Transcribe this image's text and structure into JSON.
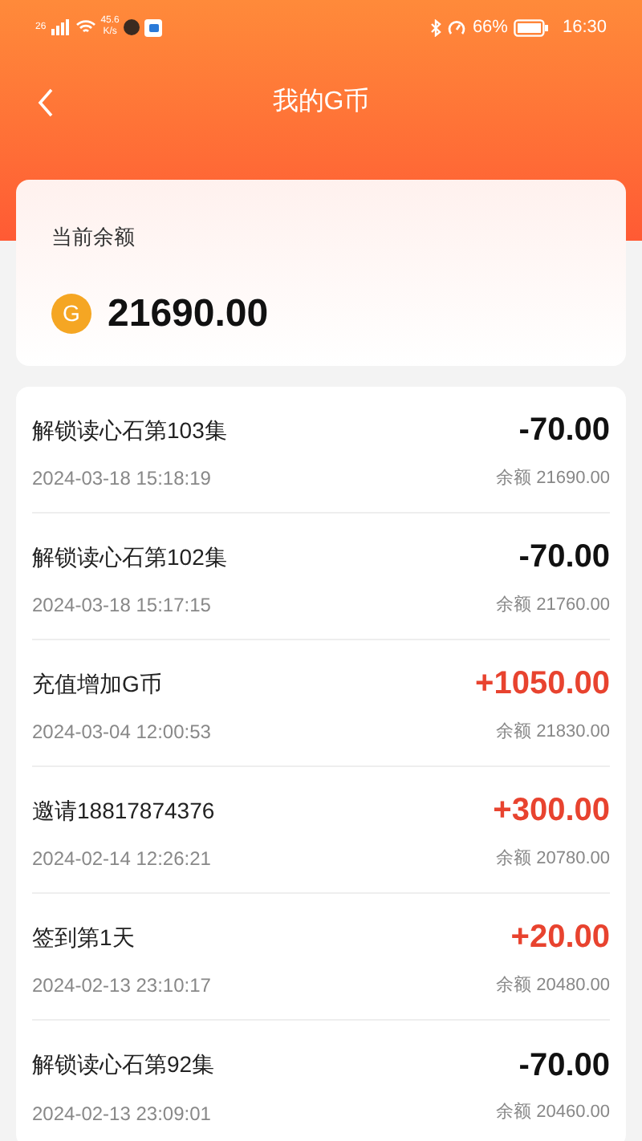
{
  "status_bar": {
    "network": "26",
    "speed": "45.6",
    "speed_unit": "K/s",
    "battery": "66%",
    "time": "16:30"
  },
  "header": {
    "title": "我的G币"
  },
  "balance": {
    "label": "当前余额",
    "coin": "G",
    "amount": "21690.00"
  },
  "records": [
    {
      "title": "解锁读心石第103集",
      "time": "2024-03-18 15:18:19",
      "amount": "-70.00",
      "kind": "expense",
      "balance": "余额 21690.00"
    },
    {
      "title": "解锁读心石第102集",
      "time": "2024-03-18 15:17:15",
      "amount": "-70.00",
      "kind": "expense",
      "balance": "余额 21760.00"
    },
    {
      "title": "充值增加G币",
      "time": "2024-03-04 12:00:53",
      "amount": "+1050.00",
      "kind": "income",
      "balance": "余额 21830.00"
    },
    {
      "title": "邀请18817874376",
      "time": "2024-02-14 12:26:21",
      "amount": "+300.00",
      "kind": "income",
      "balance": "余额 20780.00"
    },
    {
      "title": "签到第1天",
      "time": "2024-02-13 23:10:17",
      "amount": "+20.00",
      "kind": "income",
      "balance": "余额 20480.00"
    },
    {
      "title": "解锁读心石第92集",
      "time": "2024-02-13 23:09:01",
      "amount": "-70.00",
      "kind": "expense",
      "balance": "余额 20460.00"
    }
  ]
}
